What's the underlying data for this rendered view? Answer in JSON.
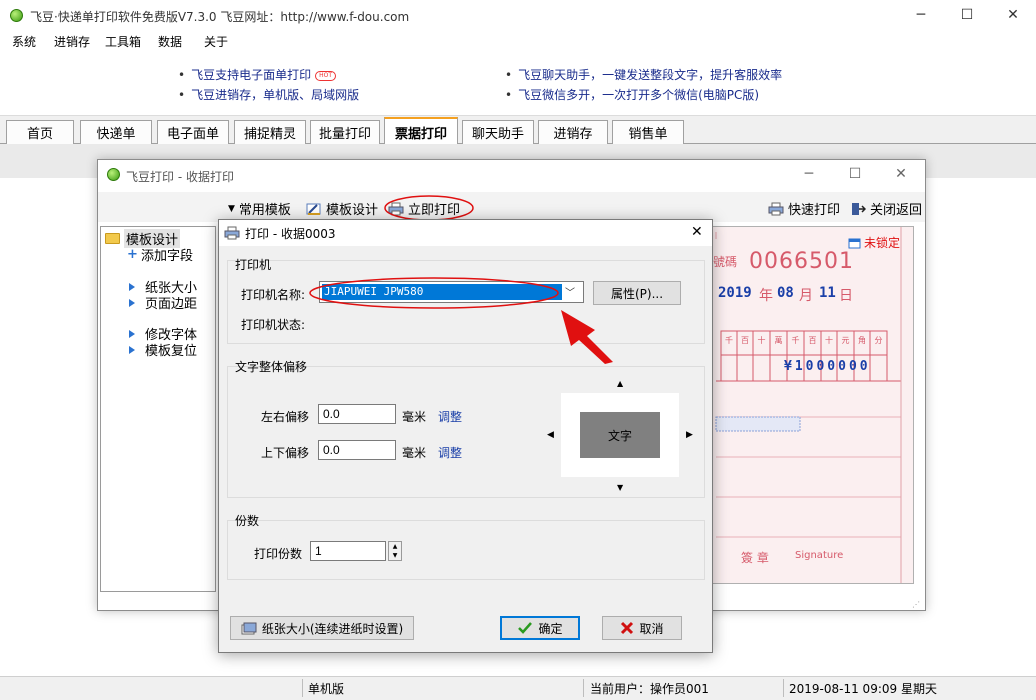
{
  "app": {
    "title": "飞豆·快递单打印软件免费版V7.3.0   飞豆网址：http://www.f-dou.com",
    "minimize": "─",
    "maximize": "☐",
    "close": "✕"
  },
  "menu": [
    "系统",
    "进销存",
    "工具箱",
    "数据",
    "关于"
  ],
  "banner": {
    "left": [
      "飞豆支持电子面单打印",
      "飞豆进销存，单机版、局域网版"
    ],
    "right": [
      "飞豆聊天助手，一键发送整段文字，提升客服效率",
      "飞豆微信多开，一次打开多个微信(电脑PC版)"
    ],
    "hot": "HOT"
  },
  "tabs": [
    "首页",
    "快递单",
    "电子面单",
    "捕捉精灵",
    "批量打印",
    "票据打印",
    "聊天助手",
    "进销存",
    "销售单"
  ],
  "receipt_window": {
    "title": "飞豆打印 - 收据打印",
    "toolbar": {
      "templates": "常用模板",
      "design": "模板设计",
      "print_now": "立即打印",
      "quick_print": "快速打印",
      "close_back": "关闭返回"
    },
    "tree": {
      "root": "模板设计",
      "items": [
        "添加字段",
        "纸张大小",
        "页面边距",
        "修改字体",
        "模板复位"
      ]
    },
    "preview": {
      "unlocked": "未锁定",
      "number_label": "號碼",
      "number": "0066501",
      "date_year": "2019",
      "date_month": "08",
      "date_day": "11",
      "year_char": "年",
      "month_char": "月",
      "day_char": "日",
      "amount": "¥1000000",
      "digit_headers": [
        "千",
        "百",
        "十",
        "萬",
        "千",
        "百",
        "十",
        "元",
        "角",
        "分"
      ],
      "seal": "簽 章",
      "signature": "Signature"
    }
  },
  "print_dialog": {
    "title": "打印 - 收据0003",
    "printer_group": "打印机",
    "printer_name_label": "打印机名称:",
    "printer_name": "JIAPUWEI JPW580",
    "properties_btn": "属性(P)...",
    "printer_status_label": "打印机状态:",
    "offset_group": "文字整体偏移",
    "lr_label": "左右偏移",
    "lr_value": "0.0",
    "ud_label": "上下偏移",
    "ud_value": "0.0",
    "unit": "毫米",
    "adjust": "调整",
    "text_sample": "文字",
    "copies_group": "份数",
    "copies_label": "打印份数",
    "copies_value": "1",
    "paper_btn": "纸张大小(连续进纸时设置)",
    "ok": "确定",
    "cancel": "取消"
  },
  "status": {
    "mode": "单机版",
    "user": "当前用户：操作员001",
    "datetime": "2019-08-11 09:09 星期天"
  },
  "colors": {
    "accent_orange": "#f4a020",
    "highlight_blue": "#0078d7",
    "annotation_red": "#e01010",
    "link_blue": "#1a3fa8"
  }
}
